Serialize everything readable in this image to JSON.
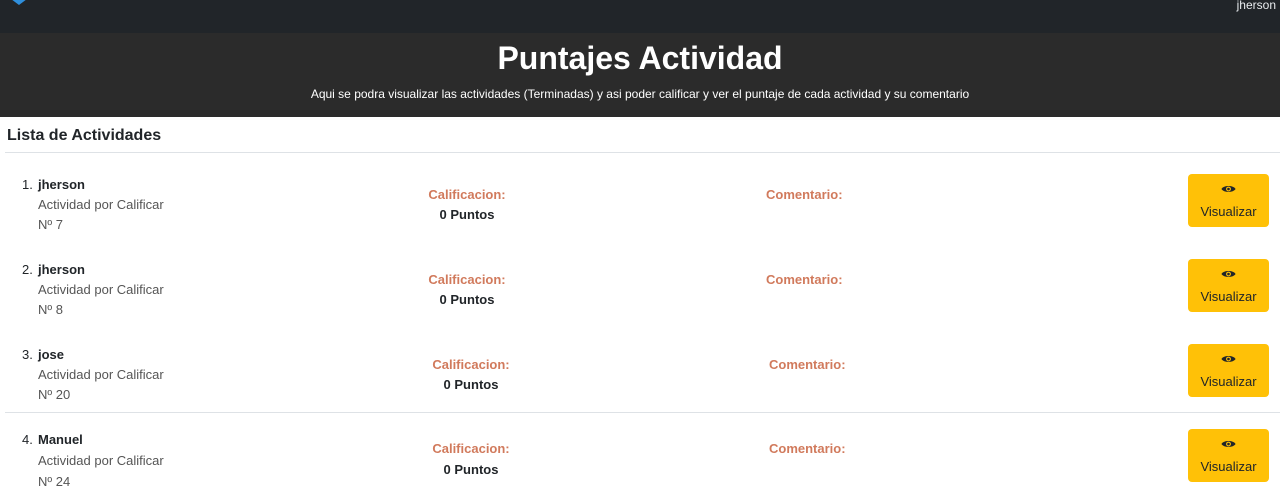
{
  "nav": {
    "user_name": "jherson",
    "logo_icon": "shield-logo-icon"
  },
  "header": {
    "title": "Puntajes Actividad",
    "subtitle": "Aqui se podra visualizar las actividades (Terminadas) y asi poder calificar y ver el puntaje de cada actividad y su comentario"
  },
  "list": {
    "title": "Lista de Actividades",
    "items": [
      {
        "number": "1.",
        "name": "jherson",
        "description": "Actividad por Calificar",
        "numero": "Nº 7",
        "calificacion_label": "Calificacion:",
        "calificacion_value": "0 Puntos",
        "comentario_label": "Comentario:",
        "button_label": "Visualizar"
      },
      {
        "number": "2.",
        "name": "jherson",
        "description": "Actividad por Calificar",
        "numero": "Nº 8",
        "calificacion_label": "Calificacion:",
        "calificacion_value": "0 Puntos",
        "comentario_label": "Comentario:",
        "button_label": "Visualizar"
      },
      {
        "number": "3.",
        "name": "jose",
        "description": "Actividad por Calificar",
        "numero": "Nº 20",
        "calificacion_label": "Calificacion:",
        "calificacion_value": "0 Puntos",
        "comentario_label": "Comentario:",
        "button_label": "Visualizar"
      },
      {
        "number": "4.",
        "name": "Manuel",
        "description": "Actividad por Calificar",
        "numero": "Nº 24",
        "calificacion_label": "Calificacion:",
        "calificacion_value": "0 Puntos",
        "comentario_label": "Comentario:",
        "button_label": "Visualizar"
      }
    ]
  },
  "colors": {
    "accent_button": "#ffc107",
    "label_accent": "#d17a5c",
    "navbar": "#212529"
  }
}
